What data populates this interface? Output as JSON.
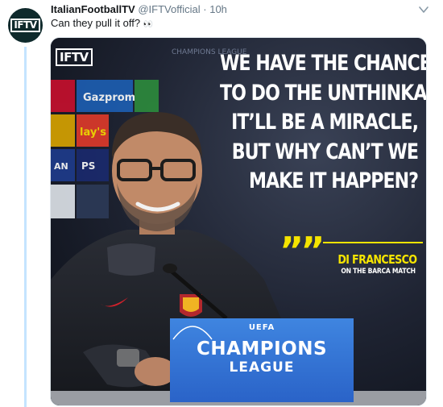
{
  "tweet": {
    "display_name": "ItalianFootballTV",
    "handle": "@IFTVofficial",
    "separator": "·",
    "time": "10h",
    "text": "Can they pull it off?",
    "emoji": "👀",
    "avatar_label": "IFTV"
  },
  "media": {
    "brand_badge": "IFTV",
    "quote_lines": [
      "WE HAVE THE CHANCE",
      "TO DO THE UNTHINKABLE.",
      "IT’LL BE A MIRACLE,",
      "BUT WHY CAN’T WE",
      "MAKE IT HAPPEN?"
    ],
    "quote_marks": "”",
    "speaker": "DI FRANCESCO",
    "speaker_subtitle": "ON THE BARCA MATCH",
    "board": {
      "uefa": "UEFA",
      "title": "CHAMPIONS",
      "subtitle": "LEAGUE"
    },
    "background_sponsors": [
      "Gazprom",
      "lay's",
      "PS",
      "AN"
    ],
    "backdrop_label": "CHAMPIONS LEAGUE"
  },
  "colors": {
    "name": "#14171a",
    "muted": "#657786",
    "thread_line": "#c4e4ff",
    "quote_accent": "#f5e400",
    "ucl_blue": "#2f6fd6"
  },
  "icons": {
    "caret": "chevron-down-icon"
  }
}
